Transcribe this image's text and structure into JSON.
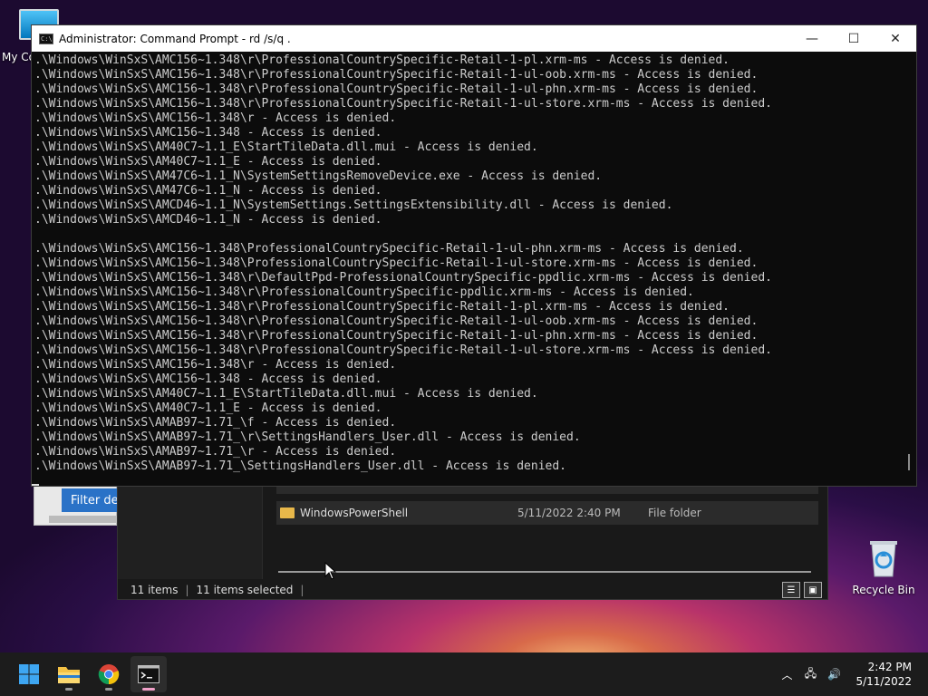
{
  "desktop": {
    "mypc_label": "My Co",
    "recycle_label": "Recycle Bin"
  },
  "cmd": {
    "title": "Administrator: Command Prompt - rd  /s/q .",
    "minimize": "—",
    "maximize": "☐",
    "close": "✕",
    "lines": [
      ".\\Windows\\WinSxS\\AMC156~1.348\\r\\ProfessionalCountrySpecific-Retail-1-pl.xrm-ms - Access is denied.",
      ".\\Windows\\WinSxS\\AMC156~1.348\\r\\ProfessionalCountrySpecific-Retail-1-ul-oob.xrm-ms - Access is denied.",
      ".\\Windows\\WinSxS\\AMC156~1.348\\r\\ProfessionalCountrySpecific-Retail-1-ul-phn.xrm-ms - Access is denied.",
      ".\\Windows\\WinSxS\\AMC156~1.348\\r\\ProfessionalCountrySpecific-Retail-1-ul-store.xrm-ms - Access is denied.",
      ".\\Windows\\WinSxS\\AMC156~1.348\\r - Access is denied.",
      ".\\Windows\\WinSxS\\AMC156~1.348 - Access is denied.",
      ".\\Windows\\WinSxS\\AM40C7~1.1_E\\StartTileData.dll.mui - Access is denied.",
      ".\\Windows\\WinSxS\\AM40C7~1.1_E - Access is denied.",
      ".\\Windows\\WinSxS\\AM47C6~1.1_N\\SystemSettingsRemoveDevice.exe - Access is denied.",
      ".\\Windows\\WinSxS\\AM47C6~1.1_N - Access is denied.",
      ".\\Windows\\WinSxS\\AMCD46~1.1_N\\SystemSettings.SettingsExtensibility.dll - Access is denied.",
      ".\\Windows\\WinSxS\\AMCD46~1.1_N - Access is denied.",
      "",
      ".\\Windows\\WinSxS\\AMC156~1.348\\ProfessionalCountrySpecific-Retail-1-ul-phn.xrm-ms - Access is denied.",
      ".\\Windows\\WinSxS\\AMC156~1.348\\ProfessionalCountrySpecific-Retail-1-ul-store.xrm-ms - Access is denied.",
      ".\\Windows\\WinSxS\\AMC156~1.348\\r\\DefaultPpd-ProfessionalCountrySpecific-ppdlic.xrm-ms - Access is denied.",
      ".\\Windows\\WinSxS\\AMC156~1.348\\r\\ProfessionalCountrySpecific-ppdlic.xrm-ms - Access is denied.",
      ".\\Windows\\WinSxS\\AMC156~1.348\\r\\ProfessionalCountrySpecific-Retail-1-pl.xrm-ms - Access is denied.",
      ".\\Windows\\WinSxS\\AMC156~1.348\\r\\ProfessionalCountrySpecific-Retail-1-ul-oob.xrm-ms - Access is denied.",
      ".\\Windows\\WinSxS\\AMC156~1.348\\r\\ProfessionalCountrySpecific-Retail-1-ul-phn.xrm-ms - Access is denied.",
      ".\\Windows\\WinSxS\\AMC156~1.348\\r\\ProfessionalCountrySpecific-Retail-1-ul-store.xrm-ms - Access is denied.",
      ".\\Windows\\WinSxS\\AMC156~1.348\\r - Access is denied.",
      ".\\Windows\\WinSxS\\AMC156~1.348 - Access is denied.",
      ".\\Windows\\WinSxS\\AM40C7~1.1_E\\StartTileData.dll.mui - Access is denied.",
      ".\\Windows\\WinSxS\\AM40C7~1.1_E - Access is denied.",
      ".\\Windows\\WinSxS\\AMAB97~1.71_\\f - Access is denied.",
      ".\\Windows\\WinSxS\\AMAB97~1.71_\\r\\SettingsHandlers_User.dll - Access is denied.",
      ".\\Windows\\WinSxS\\AMAB97~1.71_\\r - Access is denied.",
      ".\\Windows\\WinSxS\\AMAB97~1.71_\\SettingsHandlers_User.dll - Access is denied."
    ]
  },
  "explorer": {
    "rows": [
      {
        "name": "WindowsPowerShell",
        "date": "5/11/2022 2:40 PM",
        "type": "File folder"
      }
    ],
    "status_items": "11 items",
    "status_selected": "11 items selected"
  },
  "filter_button": "Filter defi",
  "taskbar": {
    "apps": [
      "start-icon",
      "file-explorer-icon",
      "chrome-icon",
      "terminal-icon"
    ],
    "time": "2:42 PM",
    "date": "5/11/2022"
  }
}
